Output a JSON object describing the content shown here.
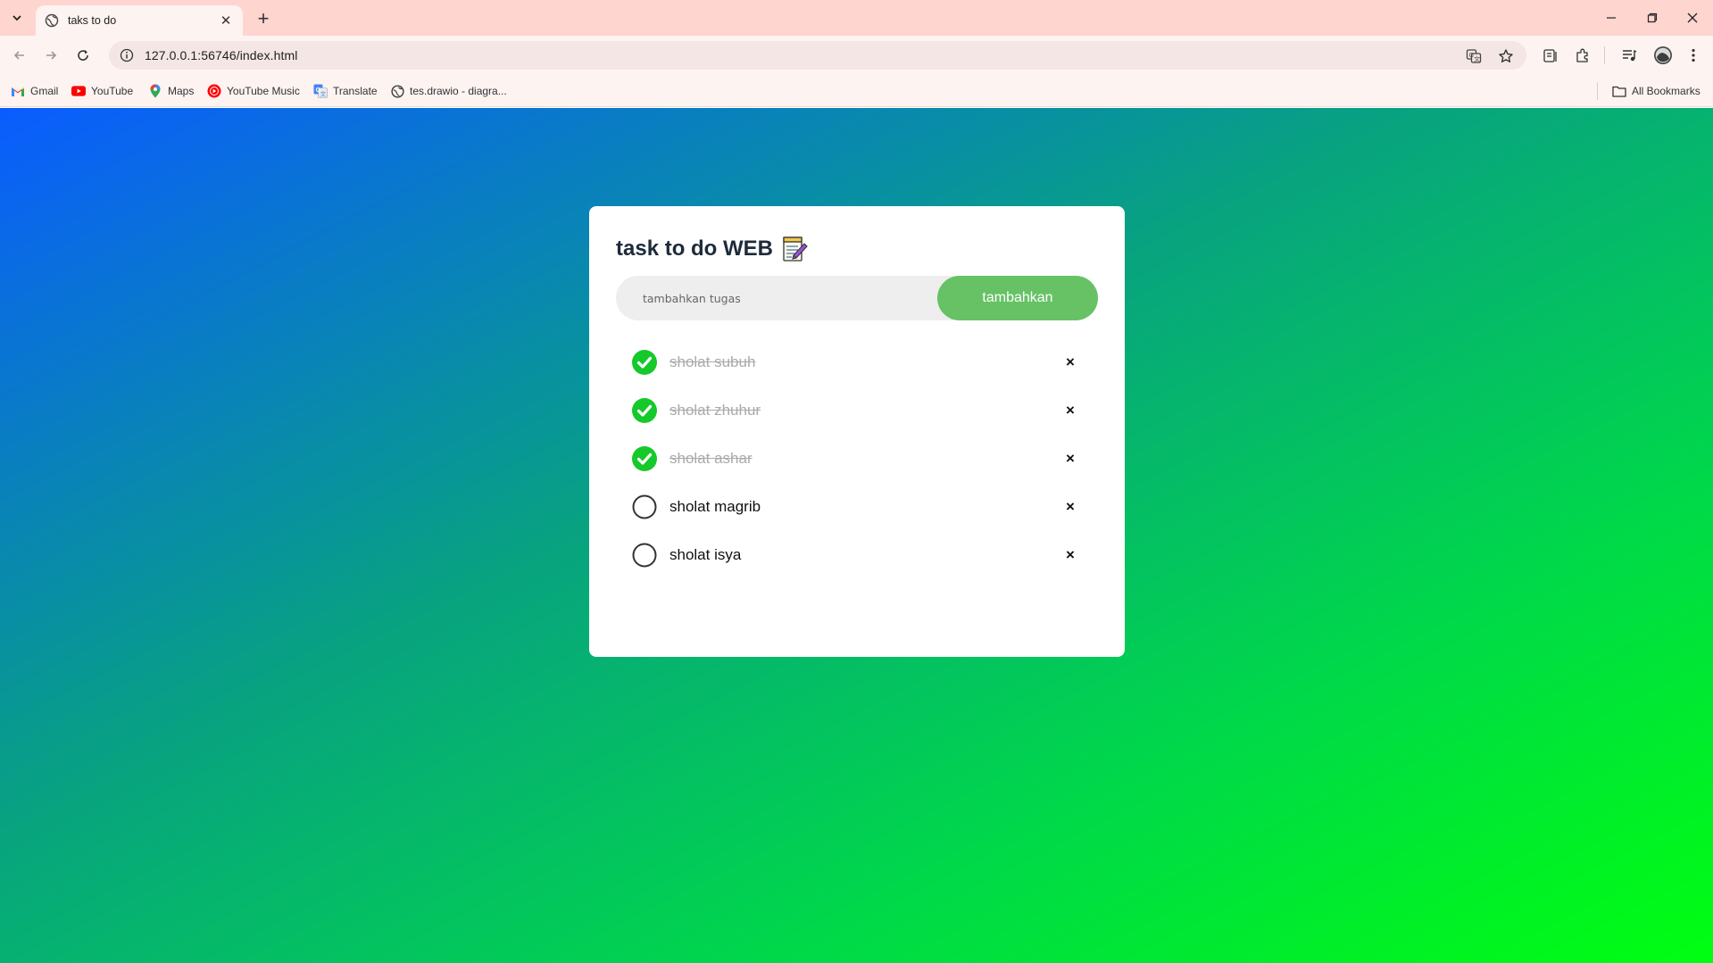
{
  "browser": {
    "tab_title": "taks to do",
    "url": "127.0.0.1:56746/index.html",
    "bookmarks": [
      {
        "label": "Gmail",
        "icon": "gmail-icon"
      },
      {
        "label": "YouTube",
        "icon": "youtube-icon"
      },
      {
        "label": "Maps",
        "icon": "maps-icon"
      },
      {
        "label": "YouTube Music",
        "icon": "youtube-music-icon"
      },
      {
        "label": "Translate",
        "icon": "translate-icon"
      },
      {
        "label": "tes.drawio - diagra...",
        "icon": "globe-icon"
      }
    ],
    "all_bookmarks_label": "All Bookmarks"
  },
  "app": {
    "title": "task to do WEB",
    "title_icon": "notepad-icon",
    "input_placeholder": "tambahkan tugas",
    "add_button_label": "tambahkan",
    "accent_color": "#66c265",
    "check_color": "#15c92a",
    "tasks": [
      {
        "label": "sholat subuh",
        "done": true
      },
      {
        "label": "sholat zhuhur",
        "done": true
      },
      {
        "label": "sholat ashar",
        "done": true
      },
      {
        "label": "sholat magrib",
        "done": false
      },
      {
        "label": "sholat isya",
        "done": false
      }
    ],
    "remove_symbol": "×"
  }
}
